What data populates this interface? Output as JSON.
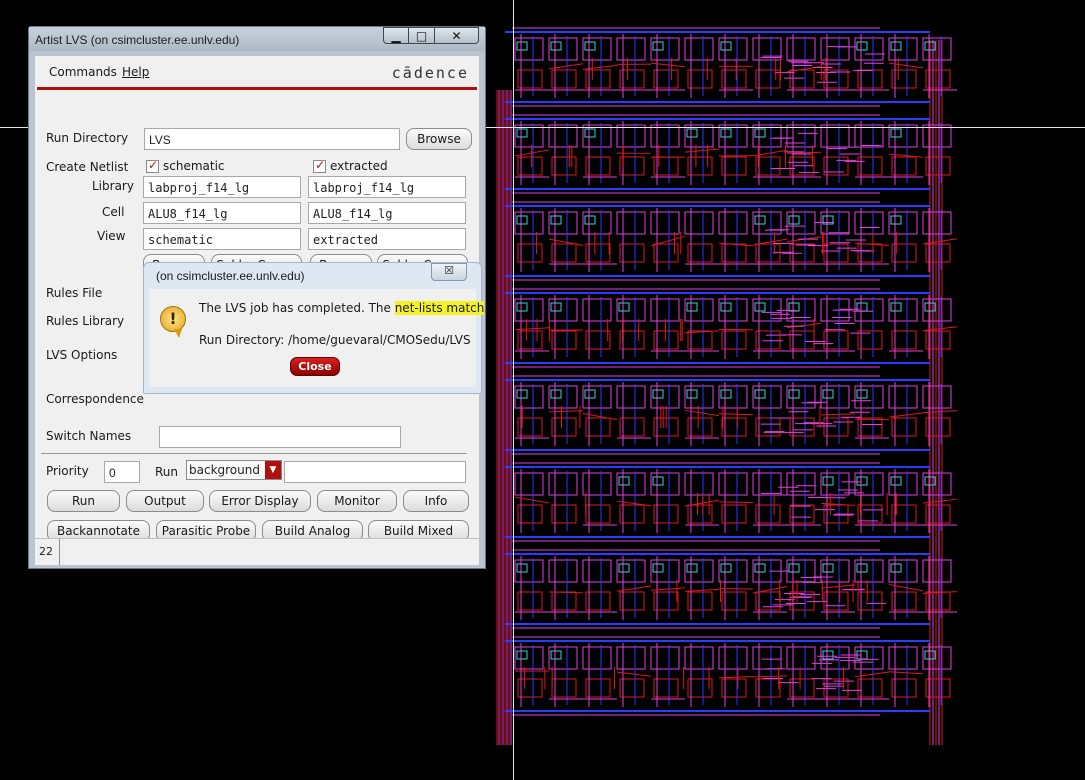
{
  "window": {
    "title": "Artist LVS (on csimcluster.ee.unlv.edu)",
    "controls": {
      "minimize": "▁",
      "maximize": "□",
      "close": "✕"
    }
  },
  "menu": {
    "items": [
      "Commands",
      "Help"
    ],
    "brand": "cādence",
    "brand_color": "#b01010"
  },
  "form": {
    "run_directory": {
      "label": "Run Directory",
      "value": "LVS",
      "browse": "Browse"
    },
    "create_netlist": {
      "label": "Create Netlist",
      "schematic": {
        "checkbox_label": "schematic",
        "checked": true,
        "library": "labproj_f14_lg",
        "cell": "ALU8_f14_lg",
        "view": "schematic"
      },
      "extracted": {
        "checkbox_label": "extracted",
        "checked": true,
        "library": "labproj_f14_lg",
        "cell": "ALU8_f14_lg",
        "view": "extracted"
      },
      "library_label": "Library",
      "cell_label": "Cell",
      "view_label": "View",
      "browse": "Browse",
      "sel_by_cursor": "Sel by Cursor"
    },
    "rules_file_label": "Rules File",
    "rules_library_label": "Rules Library",
    "lvs_options_label": "LVS Options",
    "correspondence_label": "Correspondence",
    "switch_names": {
      "label": "Switch Names",
      "value": ""
    },
    "priority": {
      "label": "Priority",
      "value": "0"
    },
    "run_mode": {
      "label": "Run",
      "value": "background",
      "extra": ""
    },
    "buttons_row1": [
      "Run",
      "Output",
      "Error Display",
      "Monitor",
      "Info"
    ],
    "buttons_row2": [
      "Backannotate",
      "Parasitic Probe",
      "Build Analog",
      "Build Mixed"
    ]
  },
  "status": {
    "line": "22"
  },
  "dialog": {
    "title": "(on csimcluster.ee.unlv.edu)",
    "close_x": "☒",
    "message_before": "The LVS job has completed. The ",
    "message_highlight": "net-lists match",
    "message_after": ".",
    "run_directory": "Run Directory: /home/guevaral/CMOSedu/LVS",
    "button": "Close",
    "highlight_color": "#f2f226"
  },
  "layout_view": {
    "rows": 8,
    "colors": {
      "metal1": "#2a3cff",
      "metal2": "#e040e0",
      "poly": "#e01818",
      "diff": "#3ad0d0",
      "crosshair": "#e6e6e6"
    }
  }
}
